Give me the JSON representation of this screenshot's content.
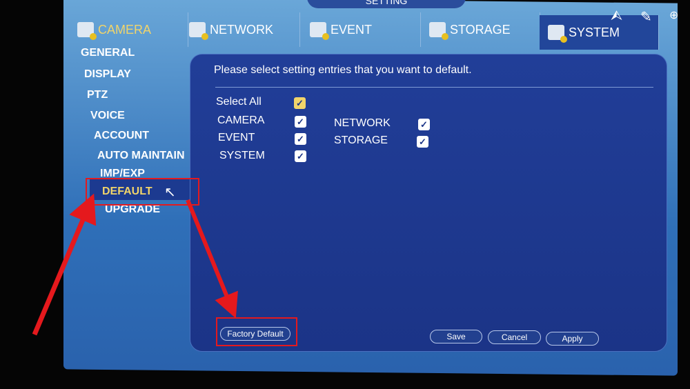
{
  "window_title": "SETTING",
  "tabs": [
    {
      "label": "CAMERA",
      "icon": "camera-icon"
    },
    {
      "label": "NETWORK",
      "icon": "network-icon"
    },
    {
      "label": "EVENT",
      "icon": "event-icon"
    },
    {
      "label": "STORAGE",
      "icon": "storage-icon"
    },
    {
      "label": "SYSTEM",
      "icon": "system-icon",
      "active": true
    }
  ],
  "sidebar": {
    "items": [
      "GENERAL",
      "DISPLAY",
      "PTZ",
      "VOICE",
      "ACCOUNT",
      "AUTO MAINTAIN",
      "IMP/EXP",
      "DEFAULT",
      "UPGRADE"
    ],
    "selected": "DEFAULT"
  },
  "content": {
    "instruction": "Please select setting entries that you want to default.",
    "select_all": {
      "label": "Select All",
      "checked": true
    },
    "entries": [
      {
        "label": "CAMERA",
        "checked": true
      },
      {
        "label": "NETWORK",
        "checked": true
      },
      {
        "label": "EVENT",
        "checked": true
      },
      {
        "label": "STORAGE",
        "checked": true
      },
      {
        "label": "SYSTEM",
        "checked": true
      }
    ],
    "factory_default": "Factory Default",
    "save": "Save",
    "cancel": "Cancel",
    "apply": "Apply"
  },
  "overlay_icons": [
    "share-icon",
    "pencil-icon",
    "zoom-in-icon"
  ],
  "colors": {
    "annotation": "#e5191d",
    "selected_text": "#f1d46a",
    "panel": "#1b3487"
  }
}
